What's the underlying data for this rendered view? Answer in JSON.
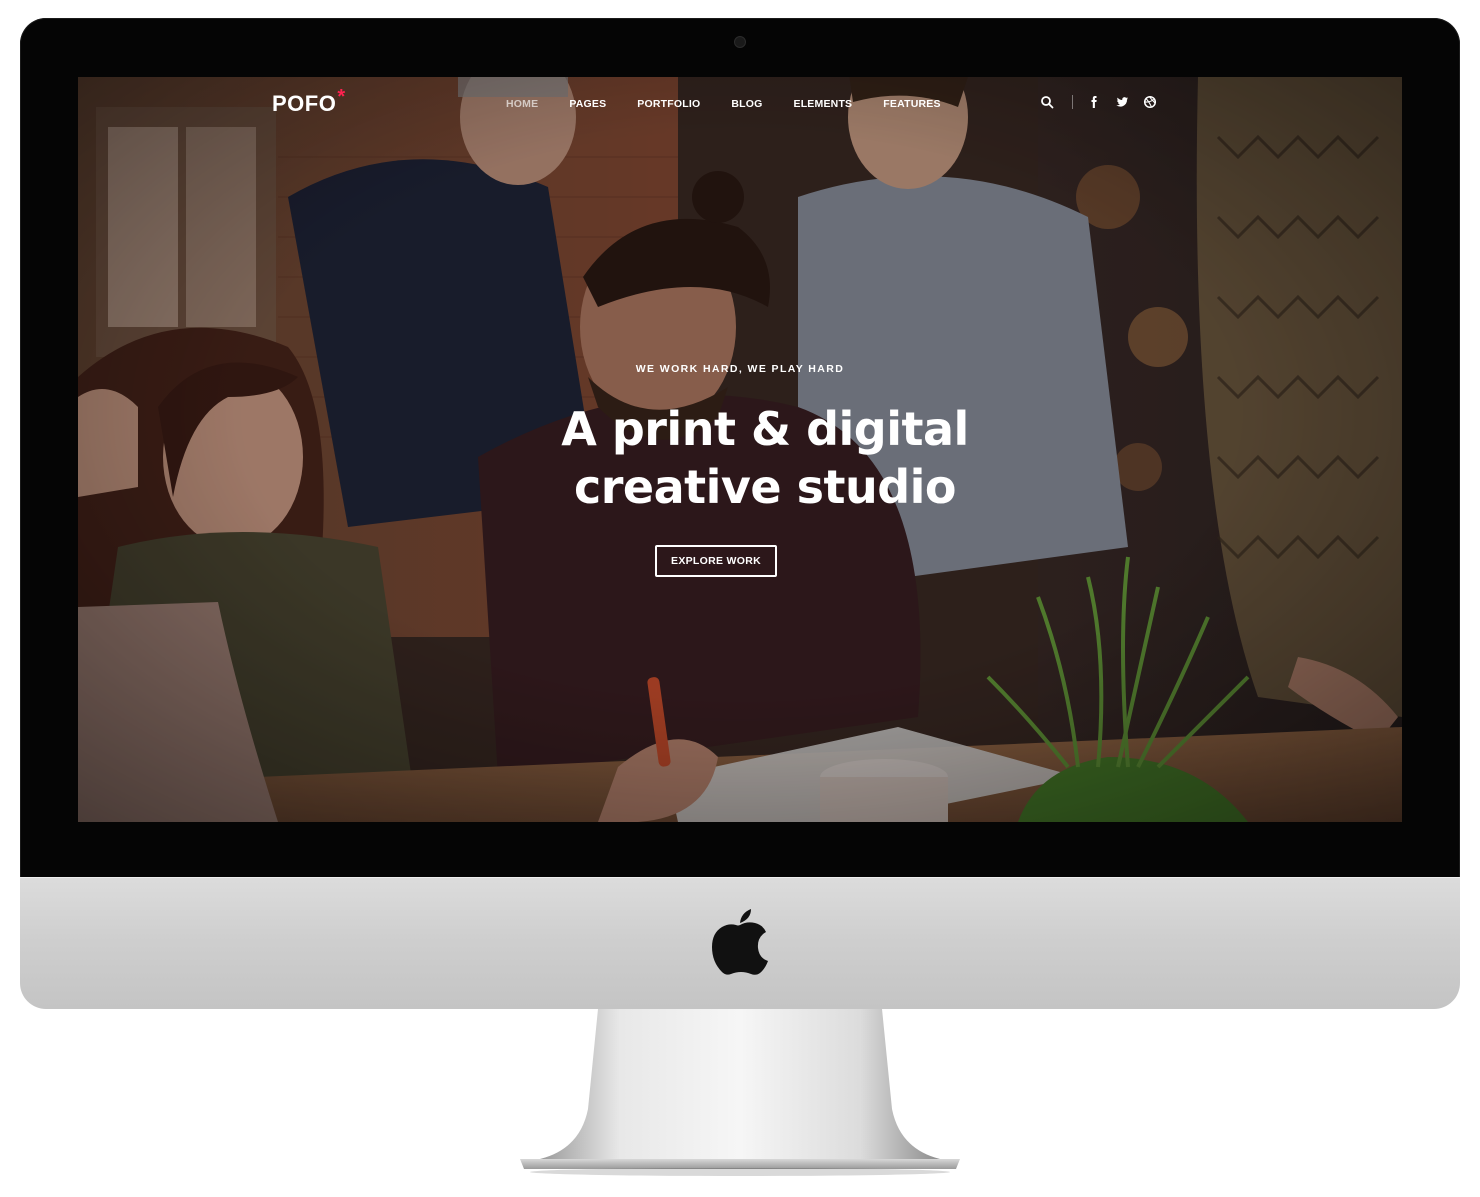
{
  "site": {
    "logo_text": "POFO",
    "logo_mark": "*",
    "accent_color": "#ff214f"
  },
  "nav": {
    "items": [
      {
        "label": "HOME",
        "active": true
      },
      {
        "label": "PAGES"
      },
      {
        "label": "PORTFOLIO"
      },
      {
        "label": "BLOG"
      },
      {
        "label": "ELEMENTS"
      },
      {
        "label": "FEATURES"
      }
    ],
    "icons": [
      "search-icon",
      "facebook-icon",
      "twitter-icon",
      "dribbble-icon"
    ]
  },
  "hero": {
    "eyebrow": "WE WORK HARD, WE PLAY HARD",
    "headline_line1": "A print & digital",
    "headline_line2": "creative studio",
    "cta_label": "EXPLORE WORK"
  },
  "device": {
    "frame": "iMac",
    "logo": "apple-logo-icon"
  }
}
